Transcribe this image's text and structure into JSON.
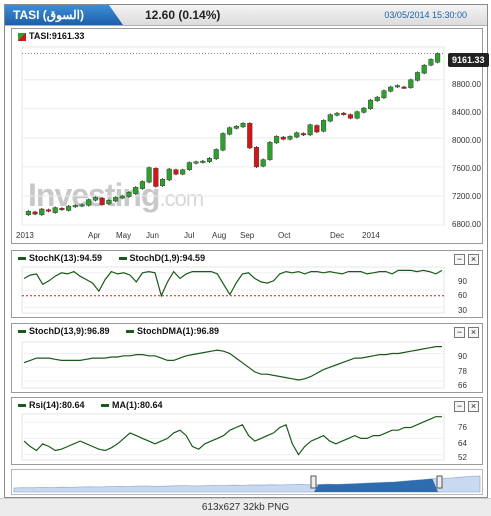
{
  "header": {
    "tab_label": "TASI (السوق)",
    "last_price": "12.60 (0.14%)",
    "timestamp": "03/05/2014 15:30:00"
  },
  "main_chart": {
    "symbol_label": "TASI:9161.33",
    "last_value_label": "9161.33",
    "watermark_main": "Investing",
    "watermark_suffix": ".com",
    "y_ticks": [
      "8800.00",
      "8400.00",
      "8000.00",
      "7600.00",
      "7200.00",
      "6800.00"
    ],
    "x_ticks": [
      "2013",
      "Apr",
      "May",
      "Jun",
      "Jul",
      "Aug",
      "Sep",
      "Oct",
      "Dec",
      "2014"
    ]
  },
  "indicators": [
    {
      "label": "StochK(13):94.59",
      "label2": "StochD(1,9):94.59",
      "y_ticks": [
        "90",
        "60",
        "30"
      ],
      "swatch1": "#1a5a1a",
      "swatch2": "#1a5a1a"
    },
    {
      "label": "StochD(13,9):96.89",
      "label2": "StochDMA(1):96.89",
      "y_ticks": [
        "90",
        "78",
        "66"
      ],
      "swatch1": "#1a5a1a",
      "swatch2": "#1a5a1a"
    },
    {
      "label": "Rsi(14):80.64",
      "label2": "MA(1):80.64",
      "y_ticks": [
        "76",
        "64",
        "52"
      ],
      "swatch1": "#1a5a1a",
      "swatch2": "#1a5a1a"
    }
  ],
  "status_bar": {
    "text": "613x627  32kb  PNG"
  },
  "colors": {
    "up": "#2e9e2e",
    "down": "#d01818",
    "line": "#1a5a1a",
    "accent": "#1d5fa8"
  },
  "chart_data": [
    {
      "type": "candlestick",
      "title": "TASI:9161.33",
      "ylim": [
        6800,
        9250
      ],
      "y_ticks": [
        6800,
        7200,
        7600,
        8000,
        8400,
        8800
      ],
      "x_ticks": [
        "2013",
        "Apr",
        "May",
        "Jun",
        "Jul",
        "Aug",
        "Sep",
        "Oct",
        "Dec",
        "2014"
      ],
      "reference_line": 9161.33,
      "candles": [
        {
          "o": 6940,
          "c": 6990
        },
        {
          "o": 6980,
          "c": 6950
        },
        {
          "o": 6940,
          "c": 7020
        },
        {
          "o": 7010,
          "c": 6990
        },
        {
          "o": 6970,
          "c": 7040
        },
        {
          "o": 7030,
          "c": 7010
        },
        {
          "o": 7000,
          "c": 7060
        },
        {
          "o": 7050,
          "c": 7070
        },
        {
          "o": 7060,
          "c": 7080
        },
        {
          "o": 7070,
          "c": 7150
        },
        {
          "o": 7140,
          "c": 7180
        },
        {
          "o": 7170,
          "c": 7080
        },
        {
          "o": 7090,
          "c": 7140
        },
        {
          "o": 7130,
          "c": 7180
        },
        {
          "o": 7170,
          "c": 7200
        },
        {
          "o": 7190,
          "c": 7250
        },
        {
          "o": 7230,
          "c": 7320
        },
        {
          "o": 7300,
          "c": 7400
        },
        {
          "o": 7390,
          "c": 7590
        },
        {
          "o": 7580,
          "c": 7330
        },
        {
          "o": 7340,
          "c": 7430
        },
        {
          "o": 7420,
          "c": 7570
        },
        {
          "o": 7560,
          "c": 7500
        },
        {
          "o": 7500,
          "c": 7560
        },
        {
          "o": 7560,
          "c": 7660
        },
        {
          "o": 7650,
          "c": 7670
        },
        {
          "o": 7660,
          "c": 7680
        },
        {
          "o": 7670,
          "c": 7720
        },
        {
          "o": 7710,
          "c": 7840
        },
        {
          "o": 7830,
          "c": 8060
        },
        {
          "o": 8050,
          "c": 8140
        },
        {
          "o": 8130,
          "c": 8160
        },
        {
          "o": 8150,
          "c": 8200
        },
        {
          "o": 8200,
          "c": 7860
        },
        {
          "o": 7870,
          "c": 7600
        },
        {
          "o": 7610,
          "c": 7700
        },
        {
          "o": 7700,
          "c": 7940
        },
        {
          "o": 7930,
          "c": 8020
        },
        {
          "o": 8010,
          "c": 7980
        },
        {
          "o": 7980,
          "c": 8020
        },
        {
          "o": 8010,
          "c": 8070
        },
        {
          "o": 8060,
          "c": 8040
        },
        {
          "o": 8040,
          "c": 8180
        },
        {
          "o": 8170,
          "c": 8080
        },
        {
          "o": 8090,
          "c": 8240
        },
        {
          "o": 8230,
          "c": 8320
        },
        {
          "o": 8310,
          "c": 8340
        },
        {
          "o": 8340,
          "c": 8320
        },
        {
          "o": 8320,
          "c": 8270
        },
        {
          "o": 8270,
          "c": 8360
        },
        {
          "o": 8350,
          "c": 8410
        },
        {
          "o": 8400,
          "c": 8520
        },
        {
          "o": 8510,
          "c": 8560
        },
        {
          "o": 8550,
          "c": 8650
        },
        {
          "o": 8640,
          "c": 8700
        },
        {
          "o": 8700,
          "c": 8720
        },
        {
          "o": 8700,
          "c": 8690
        },
        {
          "o": 8690,
          "c": 8800
        },
        {
          "o": 8790,
          "c": 8900
        },
        {
          "o": 8890,
          "c": 9000
        },
        {
          "o": 9000,
          "c": 9080
        },
        {
          "o": 9040,
          "c": 9160
        }
      ]
    },
    {
      "type": "line",
      "title": "StochK(13):94.59 / StochD(1,9):94.59",
      "ylim": [
        20,
        100
      ],
      "y_ticks": [
        30,
        60,
        90
      ],
      "reference_line": 50,
      "series": [
        {
          "name": "StochK(13)",
          "values": [
            80,
            86,
            88,
            70,
            76,
            84,
            90,
            88,
            92,
            84,
            78,
            72,
            58,
            78,
            92,
            88,
            90,
            86,
            74,
            90,
            92,
            90,
            50,
            74,
            92,
            80,
            88,
            92,
            92,
            92,
            92,
            88,
            70,
            52,
            72,
            88,
            90,
            80,
            74,
            72,
            76,
            88,
            92,
            90,
            92,
            88,
            92,
            92,
            90,
            92,
            90,
            88,
            92,
            92,
            92,
            88,
            90,
            92,
            92,
            88,
            94,
            94,
            94,
            92,
            94,
            92,
            88,
            94
          ]
        }
      ]
    },
    {
      "type": "line",
      "title": "StochD(13,9):96.89 / StochDMA(1):96.89",
      "ylim": [
        60,
        100
      ],
      "y_ticks": [
        66,
        78,
        90
      ],
      "series": [
        {
          "name": "StochD(13,9)",
          "values": [
            82,
            84,
            86,
            86,
            86,
            85,
            84,
            84,
            84,
            84,
            85,
            86,
            86,
            86,
            87,
            87,
            88,
            88,
            89,
            89,
            88,
            88,
            86,
            84,
            84,
            86,
            88,
            89,
            90,
            91,
            92,
            93,
            92,
            90,
            86,
            82,
            78,
            74,
            72,
            72,
            71,
            70,
            69,
            68,
            67,
            68,
            70,
            73,
            76,
            78,
            80,
            82,
            84,
            86,
            86,
            87,
            88,
            89,
            89,
            90,
            90,
            91,
            92,
            93,
            94,
            95,
            96,
            96
          ]
        }
      ]
    },
    {
      "type": "line",
      "title": "Rsi(14):80.64 / MA(1):80.64",
      "ylim": [
        48,
        82
      ],
      "y_ticks": [
        52,
        64,
        76
      ],
      "series": [
        {
          "name": "Rsi(14)",
          "values": [
            62,
            58,
            55,
            60,
            58,
            55,
            56,
            58,
            60,
            62,
            60,
            58,
            56,
            55,
            57,
            60,
            64,
            68,
            66,
            64,
            62,
            60,
            62,
            64,
            68,
            70,
            66,
            58,
            56,
            60,
            62,
            64,
            66,
            70,
            72,
            74,
            66,
            62,
            64,
            66,
            68,
            72,
            74,
            60,
            52,
            58,
            62,
            64,
            66,
            62,
            60,
            62,
            64,
            66,
            64,
            64,
            66,
            66,
            68,
            70,
            70,
            72,
            72,
            74,
            76,
            78,
            80,
            80
          ]
        }
      ]
    },
    {
      "type": "area",
      "title": "",
      "series": [
        {
          "name": "",
          "values": [
            20,
            22,
            21,
            23,
            22,
            24,
            23,
            25,
            26,
            25,
            27,
            28,
            27,
            29,
            30,
            28,
            29,
            31,
            32,
            30,
            31,
            33,
            32,
            34,
            33,
            35,
            34,
            36,
            35,
            37,
            38,
            36,
            37,
            39,
            38,
            40,
            42,
            44,
            46,
            48,
            50,
            54,
            58,
            62,
            66,
            68,
            70,
            74,
            78,
            80
          ]
        }
      ]
    }
  ]
}
